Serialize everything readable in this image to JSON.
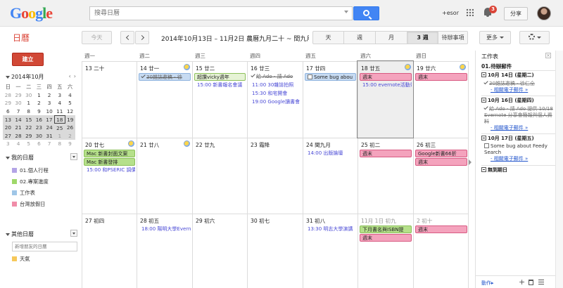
{
  "header": {
    "logo_letters": [
      "G",
      "o",
      "o",
      "g",
      "l",
      "e"
    ],
    "search_placeholder": "搜尋日曆",
    "user": "+esor",
    "notifications": "3",
    "share_label": "分享"
  },
  "toolbar": {
    "app_title": "日曆",
    "today_label": "今天",
    "date_range": "2014年10月13日 – 11月2日 農曆九月二十 ~ 閏九月初",
    "views": [
      {
        "label": "天",
        "active": false
      },
      {
        "label": "週",
        "active": false
      },
      {
        "label": "月",
        "active": false
      },
      {
        "label": "3 週",
        "active": true
      },
      {
        "label": "待辦事項",
        "active": false
      }
    ],
    "more_label": "更多"
  },
  "sidebar": {
    "create_label": "建立",
    "mini_month": "2014年10月",
    "mini_dow": [
      "日",
      "一",
      "二",
      "三",
      "四",
      "五",
      "六"
    ],
    "mini_weeks": [
      [
        {
          "d": "28",
          "o": true
        },
        {
          "d": "29",
          "o": true
        },
        {
          "d": "30",
          "o": true
        },
        {
          "d": "1"
        },
        {
          "d": "2"
        },
        {
          "d": "3"
        },
        {
          "d": "4"
        }
      ],
      [
        {
          "d": "29",
          "o": true
        },
        {
          "d": "30",
          "o": true
        },
        {
          "d": "1"
        },
        {
          "d": "2"
        },
        {
          "d": "3"
        },
        {
          "d": "4"
        },
        {
          "d": "5"
        }
      ],
      [
        {
          "d": "6"
        },
        {
          "d": "7"
        },
        {
          "d": "8"
        },
        {
          "d": "9"
        },
        {
          "d": "10"
        },
        {
          "d": "11"
        },
        {
          "d": "12"
        }
      ],
      [
        {
          "d": "13",
          "r": true
        },
        {
          "d": "14",
          "r": true
        },
        {
          "d": "15",
          "r": true
        },
        {
          "d": "16",
          "r": true
        },
        {
          "d": "17",
          "r": true
        },
        {
          "d": "18",
          "r": true,
          "t": true
        },
        {
          "d": "19",
          "r": true
        }
      ],
      [
        {
          "d": "20",
          "r": true
        },
        {
          "d": "21",
          "r": true
        },
        {
          "d": "22",
          "r": true
        },
        {
          "d": "23",
          "r": true
        },
        {
          "d": "24",
          "r": true
        },
        {
          "d": "25",
          "r": true
        },
        {
          "d": "26",
          "r": true
        }
      ],
      [
        {
          "d": "27",
          "r": true
        },
        {
          "d": "28",
          "r": true
        },
        {
          "d": "29",
          "r": true
        },
        {
          "d": "30",
          "r": true
        },
        {
          "d": "31",
          "r": true
        },
        {
          "d": "1",
          "o": true,
          "r": true
        },
        {
          "d": "2",
          "o": true,
          "r": true
        }
      ],
      [
        {
          "d": "3",
          "o": true
        },
        {
          "d": "4",
          "o": true
        },
        {
          "d": "5",
          "o": true
        },
        {
          "d": "6",
          "o": true
        },
        {
          "d": "7",
          "o": true
        },
        {
          "d": "8",
          "o": true
        },
        {
          "d": "9",
          "o": true
        }
      ]
    ],
    "my_calendars_title": "我的日曆",
    "my_calendars": [
      {
        "label": "01.個人行程",
        "color": "#b3a4e6"
      },
      {
        "label": "02.專案進度",
        "color": "#9fd86a"
      },
      {
        "label": "工作表",
        "color": "#9fc6e7"
      },
      {
        "label": "台灣放假日",
        "color": "#f08ca8"
      }
    ],
    "other_calendars_title": "其他日曆",
    "add_friend_placeholder": "新增朋友的日曆",
    "other_calendars": [
      {
        "label": "天氣",
        "color": "#f6c85a"
      }
    ]
  },
  "grid": {
    "dow": [
      "週一",
      "週二",
      "週三",
      "週四",
      "週五",
      "週六",
      "週日"
    ],
    "weeks": [
      {
        "days": [
          {
            "label": "13 二十"
          },
          {
            "label": "14 廿一",
            "weather": true,
            "events": [
              {
                "text": "30雜誌邀稿 - 徐",
                "style": "done-blue"
              }
            ]
          },
          {
            "label": "15 廿二",
            "events": [
              {
                "text": "超讚vicky週年",
                "style": "green-pale"
              },
              {
                "text": "15:00 新書報名會議",
                "style": "timed"
              }
            ]
          },
          {
            "label": "16 廿三",
            "events": [
              {
                "text": "給 Ado - 請 Ado",
                "style": "done-check"
              },
              {
                "text": "11:00 30雜誌拍照",
                "style": "timed"
              },
              {
                "text": "15:30 和宅開會",
                "style": "timed"
              },
              {
                "text": "19:00 Google讀書會",
                "style": "timed"
              }
            ]
          },
          {
            "label": "17 廿四",
            "events": [
              {
                "text": "Some bug abou",
                "style": "task-box"
              }
            ]
          },
          {
            "label": "18 廿五",
            "weather": true,
            "shaded": true,
            "selected": true,
            "events": [
              {
                "text": "週末",
                "style": "pink"
              },
              {
                "text": "15:00 evernote活動茶",
                "style": "timed"
              }
            ]
          },
          {
            "label": "19 廿六",
            "weather": true,
            "events": [
              {
                "text": "週末",
                "style": "pink"
              }
            ]
          }
        ]
      },
      {
        "days": [
          {
            "label": "20 廿七",
            "weather": true,
            "events": [
              {
                "text": "Mac 新書封面文案",
                "style": "green"
              },
              {
                "text": "Mac 新書發排",
                "style": "green"
              },
              {
                "text": "15:00 和PSERIC 調價",
                "style": "timed"
              }
            ]
          },
          {
            "label": "21 廿八",
            "weather": true
          },
          {
            "label": "22 廿九"
          },
          {
            "label": "23 霜降"
          },
          {
            "label": "24 閏九月",
            "events": [
              {
                "text": "14:00 出版論壇",
                "style": "timed"
              }
            ]
          },
          {
            "label": "25 初二",
            "events": [
              {
                "text": "週末",
                "style": "pink"
              }
            ]
          },
          {
            "label": "26 初三",
            "events": [
              {
                "text": "Google新書66折",
                "style": "pink"
              },
              {
                "text": "週末",
                "style": "pink"
              }
            ]
          }
        ]
      },
      {
        "days": [
          {
            "label": "27 初四"
          },
          {
            "label": "28 初五",
            "events": [
              {
                "text": "18:00 陽明大學Evern",
                "style": "timed"
              }
            ]
          },
          {
            "label": "29 初六"
          },
          {
            "label": "30 初七"
          },
          {
            "label": "31 初八",
            "events": [
              {
                "text": "13:30 明志大學演講",
                "style": "timed"
              }
            ]
          },
          {
            "label": "11月 1日 初九",
            "dim": true,
            "events": [
              {
                "text": "下月書名與ISBN提",
                "style": "green"
              },
              {
                "text": "週末",
                "style": "pink"
              }
            ]
          },
          {
            "label": "2 初十",
            "dim": true,
            "events": [
              {
                "text": "週末",
                "style": "pink"
              }
            ]
          }
        ]
      }
    ]
  },
  "tasks": {
    "panel_title": "工作表",
    "list_title": "01.待辦郵件",
    "groups": [
      {
        "title": "10月 14日 (星期二)",
        "items": [
          {
            "text": "30雜誌邀稿 - 徐仁全",
            "link": "- 相關電子郵件 »",
            "done": true
          }
        ]
      },
      {
        "title": "10月 16日 (星期四)",
        "items": [
          {
            "text": "給 Ado - 請 Ado 提供 10/18 Evernote 分享會簡報與個人資料",
            "link": "- 相關電子郵件 »",
            "done": true
          }
        ]
      },
      {
        "title": "10月 17日 (星期五)",
        "items": [
          {
            "text": "Some bug about Feedy Search",
            "link": "- 相關電子郵件 »",
            "done": false
          }
        ]
      },
      {
        "title": "無到期日",
        "items": []
      }
    ],
    "footer_action": "動作"
  },
  "colors": {
    "pink_bg": "#f4a3bd",
    "pink_border": "#d85a82",
    "green_bg": "#b5e08a",
    "green_border": "#8cc05a",
    "green_pale_bg": "#e6f3d5",
    "blue_bg": "#c7dbf2",
    "blue_border": "#8eb3de",
    "create_red": "#d14836"
  }
}
